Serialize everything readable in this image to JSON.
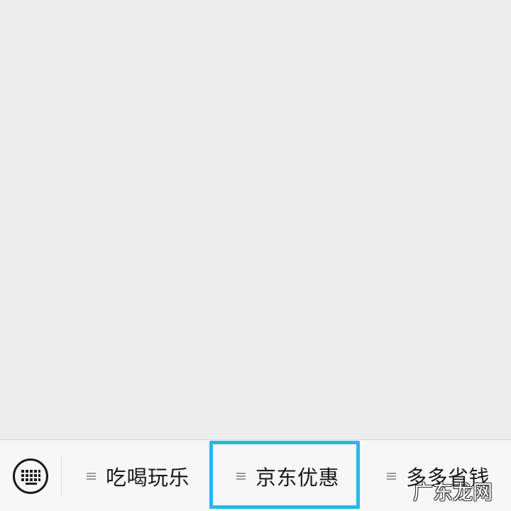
{
  "bottom_menu": {
    "keyboard_toggle_icon": "keyboard-icon",
    "items": [
      {
        "label": "吃喝玩乐",
        "icon": "menu-list-icon"
      },
      {
        "label": "京东优惠",
        "icon": "menu-list-icon"
      },
      {
        "label": "多多省钱",
        "icon": "menu-list-icon"
      }
    ]
  },
  "highlight": {
    "color": "#2eb4ec",
    "target": "京东优惠"
  },
  "watermark": {
    "text": "广东龙网"
  },
  "colors": {
    "background": "#ededed",
    "menu_bar": "#f7f7f7",
    "text": "#1a1a1a"
  }
}
